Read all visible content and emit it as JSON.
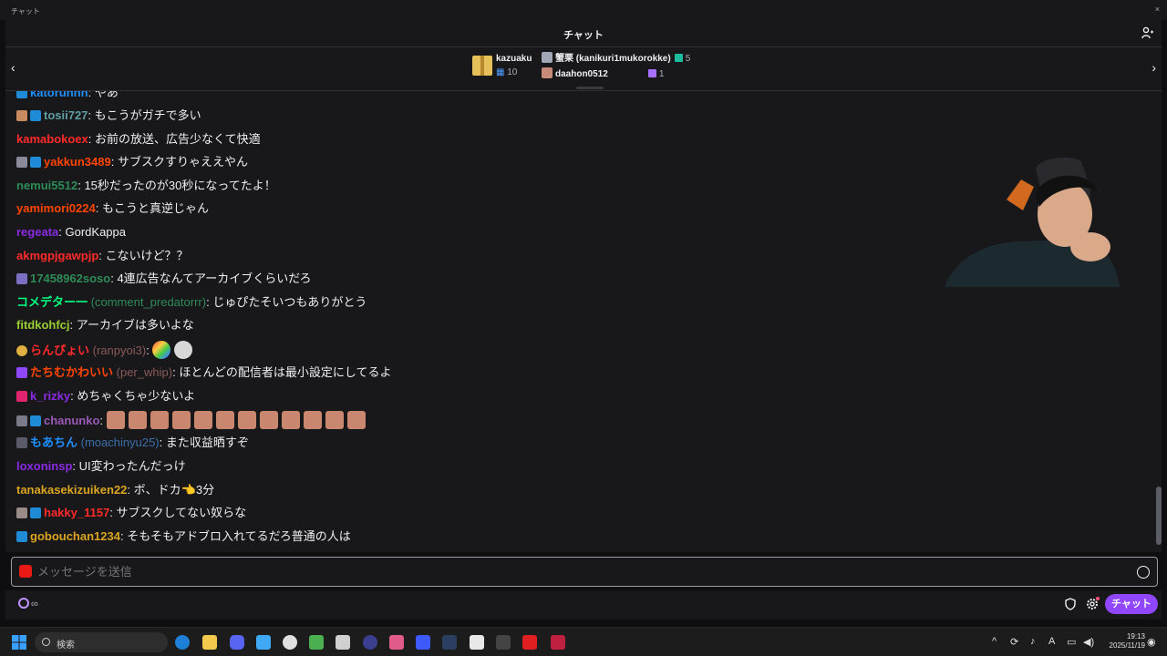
{
  "window": {
    "title": "チャット"
  },
  "header": {
    "title": "チャット"
  },
  "gifts": {
    "top": {
      "name": "kazuaku",
      "count": "10"
    },
    "rows": [
      {
        "name": "蟹栗 (kanikuri1mukorokke)",
        "count": "5"
      },
      {
        "name": "daahon0512",
        "count": "1"
      }
    ]
  },
  "messages": [
    {
      "user": "katoruhhh",
      "sep": ":",
      "text": "やあ",
      "color": "#1e90ff"
    },
    {
      "user": "tosii727",
      "sep": ":",
      "text": "もこうがガチで多い",
      "color": "#5f9ea0"
    },
    {
      "user": "kamabokoex",
      "sep": ":",
      "text": "お前の放送、広告少なくて快適",
      "color": "#ff2a2a"
    },
    {
      "user": "yakkun3489",
      "sep": ":",
      "text": "サブスクすりゃええやん",
      "color": "#ff4500"
    },
    {
      "user": "nemui5512",
      "sep": ":",
      "text": "15秒だったのが30秒になってたよ！",
      "color": "#2e8b57"
    },
    {
      "user": "yamimori0224",
      "sep": ":",
      "text": "もこうと真逆じゃん",
      "color": "#ff4500"
    },
    {
      "user": "regeata",
      "sep": ":",
      "text": "GordKappa",
      "color": "#8a2be2"
    },
    {
      "user": "akmgpjgawpjp",
      "sep": ":",
      "text": "こないけど？？",
      "color": "#ff2a2a"
    },
    {
      "user": "17458962soso",
      "sep": ":",
      "text": "4連広告なんてアーカイブくらいだろ",
      "color": "#2e8b57"
    },
    {
      "user": "コメデター一",
      "display": "(comment_predatorrr)",
      "sep": ":",
      "text": "じゅぴたそいつもありがとう",
      "color": "#00ff7f"
    },
    {
      "user": "fitdkohfcj",
      "sep": ":",
      "text": "アーカイブは多いよな",
      "color": "#9acd32"
    },
    {
      "user": "らんぴょい",
      "display": "(ranpyoi3)",
      "sep": ":",
      "text": "",
      "color": "#ff2a2a"
    },
    {
      "user": "たちむかわいい",
      "display": "(per_whip)",
      "sep": ":",
      "text": "ほとんどの配信者は最小設定にしてるよ",
      "color": "#ff4500"
    },
    {
      "user": "k_rizky",
      "sep": ":",
      "text": "めちゃくちゃ少ないよ",
      "color": "#8a2be2"
    },
    {
      "user": "chanunko",
      "sep": ":",
      "text": "",
      "color": "#9b59b6"
    },
    {
      "user": "もあちん",
      "display": "(moachinyu25)",
      "sep": ":",
      "text": "また収益晒すぞ",
      "color": "#1e90ff"
    },
    {
      "user": "loxoninsp",
      "sep": ":",
      "text": "UI変わったんだっけ",
      "color": "#8a2be2"
    },
    {
      "user": "tanakasekizuiken22",
      "sep": ":",
      "text": "ボ、ドカ👈3分",
      "color": "#daa520"
    },
    {
      "user": "hakky_1157",
      "sep": ":",
      "text": "サブスクしてない奴らな",
      "color": "#ff2a2a"
    },
    {
      "user": "gobouchan1234",
      "sep": ":",
      "text": "そもそもアドブロ入れてるだろ普通の人は",
      "color": "#daa520"
    }
  ],
  "input": {
    "placeholder": "メッセージを送信"
  },
  "bottom": {
    "points": "∞",
    "chat_button": "チャット"
  },
  "taskbar": {
    "search": "検索",
    "time": "19:13",
    "date": "2025/11/19"
  },
  "colors": {
    "accent": "#9147ff",
    "background": "#18181b"
  },
  "icons": [
    "users-icon",
    "chevron-left-icon",
    "chevron-right-icon",
    "gift-icon",
    "camera-icon",
    "emoji-icon",
    "shield-icon",
    "gear-icon",
    "windows-start-icon",
    "search-icon"
  ]
}
